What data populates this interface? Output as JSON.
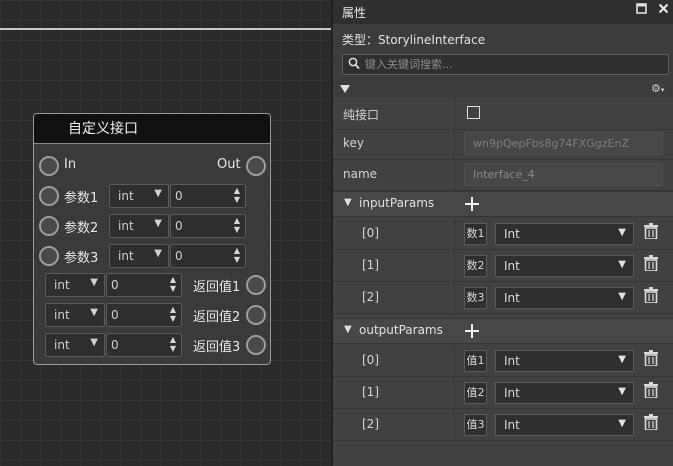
{
  "canvas": {
    "node": {
      "title": "自定义接口",
      "in_label": "In",
      "out_label": "Out",
      "params": [
        {
          "label": "参数1",
          "type": "int",
          "value": "0"
        },
        {
          "label": "参数2",
          "type": "int",
          "value": "0"
        },
        {
          "label": "参数3",
          "type": "int",
          "value": "0"
        }
      ],
      "returns": [
        {
          "label": "返回值1",
          "type": "int",
          "value": "0"
        },
        {
          "label": "返回值2",
          "type": "int",
          "value": "0"
        },
        {
          "label": "返回值3",
          "type": "int",
          "value": "0"
        }
      ]
    }
  },
  "panel": {
    "title": "属性",
    "type_line": "类型：StorylineInterface",
    "search_placeholder": "键入关键词搜索...",
    "icons": {
      "maximize": "maximize-icon",
      "close": "close-icon",
      "settings": "gear-icon"
    },
    "rows": {
      "pure_interface": {
        "label": "纯接口",
        "checked": false
      },
      "key": {
        "label": "key",
        "value": "wn9pQepFbs8g74FXGgzEnZ"
      },
      "name": {
        "label": "name",
        "value": "Interface_4"
      }
    },
    "input_params": {
      "label": "inputParams",
      "items": [
        {
          "index": "[0]",
          "badge": "数1",
          "type": "Int"
        },
        {
          "index": "[1]",
          "badge": "数2",
          "type": "Int"
        },
        {
          "index": "[2]",
          "badge": "数3",
          "type": "Int"
        }
      ]
    },
    "output_params": {
      "label": "outputParams",
      "items": [
        {
          "index": "[0]",
          "badge": "值1",
          "type": "Int"
        },
        {
          "index": "[1]",
          "badge": "值2",
          "type": "Int"
        },
        {
          "index": "[2]",
          "badge": "值3",
          "type": "Int"
        }
      ]
    }
  }
}
